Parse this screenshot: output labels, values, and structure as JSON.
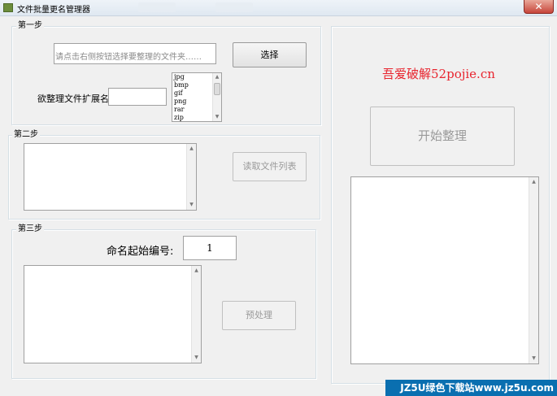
{
  "window": {
    "title": "文件批量更名管理器",
    "close_label": "✕"
  },
  "step1": {
    "legend": "第一步",
    "folder_placeholder": "请点击右侧按钮选择要整理的文件夹……",
    "select_button": "选择",
    "ext_label": "欲整理文件扩展名:",
    "ext_value": "",
    "ext_options": [
      "jpg",
      "bmp",
      "gif",
      "png",
      "rar",
      "zip"
    ]
  },
  "step2": {
    "legend": "第二步",
    "read_button": "读取文件列表"
  },
  "step3": {
    "legend": "第三步",
    "start_label": "命名起始编号:",
    "start_value": "1",
    "preview_button": "预处理"
  },
  "right": {
    "brand": "吾爱破解52pojie.cn",
    "start_button": "开始整理"
  },
  "watermark": "JZ5U绿色下载站www.jz5u.com",
  "colors": {
    "brand": "#e8242e",
    "titlebar": "#dfe8f1",
    "close": "#c7453a"
  }
}
